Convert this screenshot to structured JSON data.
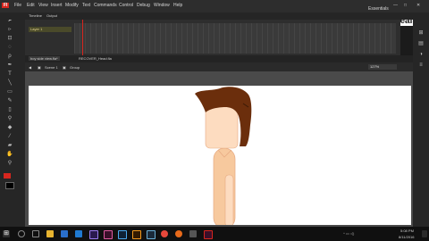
{
  "menu": [
    "Fl",
    "File",
    "Edit",
    "View",
    "Insert",
    "Modify",
    "Text",
    "Commands",
    "Control",
    "Debug",
    "Window",
    "Help"
  ],
  "workspace_label": "Essentials",
  "timeline": {
    "tabs": [
      "Timeline",
      "Output"
    ],
    "layer_name": "Layer 1"
  },
  "documents": {
    "tabs": [
      "boy side view.fla*",
      "RECOVER_Head.fla"
    ]
  },
  "edit_bar": {
    "scene": "Scene 1",
    "group": "Group",
    "zoom": "127%"
  },
  "watermark": {
    "part1": "course",
    "part2": "deals"
  },
  "taskbar": {
    "time": "5:08 PM",
    "date": "8/11/2016"
  },
  "colors": {
    "brand_logo": "#d7261e",
    "hair": "#6b2e0c",
    "skin": "#fddcc0",
    "shirt": "#f7c99e"
  },
  "icons": [
    "windows-start-icon",
    "search-icon",
    "task-view-icon",
    "file-explorer-icon",
    "edge-icon",
    "store-icon",
    "premiere-icon",
    "animate-icon",
    "photoshop-icon",
    "illustrator-icon",
    "media-encoder-icon",
    "chrome-icon",
    "firefox-icon",
    "app-icon",
    "animate-active-icon"
  ]
}
